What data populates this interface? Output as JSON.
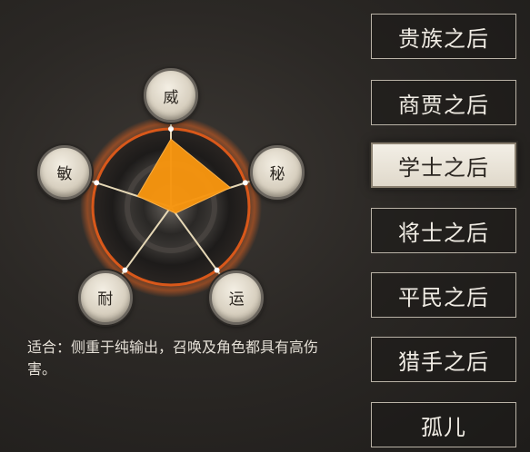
{
  "radar": {
    "attributes": [
      {
        "key": "wei",
        "label": "威",
        "value": 0.87
      },
      {
        "key": "mi",
        "label": "秘",
        "value": 0.8
      },
      {
        "key": "yun",
        "label": "运",
        "value": 0.1
      },
      {
        "key": "nai",
        "label": "耐",
        "value": 0.05
      },
      {
        "key": "min",
        "label": "敏",
        "value": 0.45
      }
    ],
    "fill_color": "#f7950f",
    "ring_color": "#d9581a",
    "spoke_color": "#e6d8b6"
  },
  "description": "适合：侧重于纯输出，召唤及角色都具有高伤害。",
  "origins": [
    {
      "label": "贵族之后",
      "selected": false
    },
    {
      "label": "商贾之后",
      "selected": false
    },
    {
      "label": "学士之后",
      "selected": true
    },
    {
      "label": "将士之后",
      "selected": false
    },
    {
      "label": "平民之后",
      "selected": false
    },
    {
      "label": "猎手之后",
      "selected": false
    },
    {
      "label": "孤儿",
      "selected": false
    }
  ]
}
